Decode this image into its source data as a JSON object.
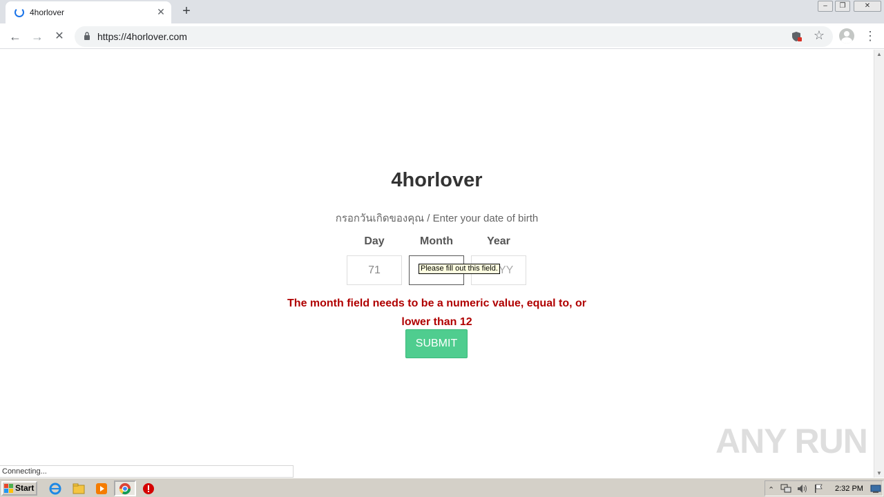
{
  "browser": {
    "tab": {
      "title": "4horlover",
      "close": "✕"
    },
    "new_tab": "+",
    "window_controls": {
      "minimize": "‒",
      "restore": "❐",
      "close": "✕"
    },
    "nav": {
      "back": "←",
      "forward": "→",
      "stop": "✕",
      "menu": "⋮"
    },
    "url": "https://4horlover.com",
    "star": "☆",
    "status": "Connecting..."
  },
  "page": {
    "title": "4horlover",
    "subtitle": "กรอกวันเกิดของคุณ / Enter your date of birth",
    "labels": {
      "day": "Day",
      "month": "Month",
      "year": "Year"
    },
    "inputs": {
      "day_value": "71",
      "month_value": "",
      "year_placeholder": "YYYY"
    },
    "tooltip": "Please fill out this field.",
    "error_line1": "The month field needs to be a numeric value, equal to, or",
    "error_line2": "lower than 12",
    "submit_label": "SUBMIT"
  },
  "watermark": "ANY RUN",
  "taskbar": {
    "start_label": "Start",
    "clock": "2:32 PM",
    "tray_up": "⌃"
  },
  "colors": {
    "submit_bg": "#4fcd8f",
    "error": "#b00000",
    "tab_strip": "#dee1e6"
  }
}
